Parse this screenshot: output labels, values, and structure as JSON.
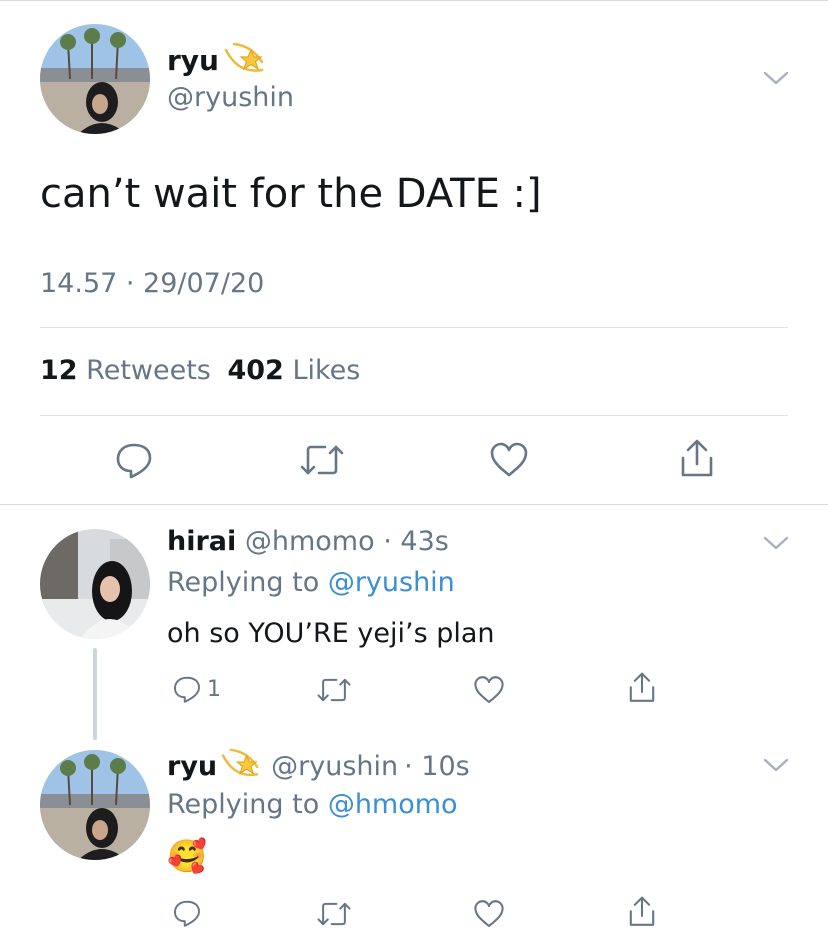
{
  "main_tweet": {
    "display_name": "ryu",
    "handle": "@ryushin",
    "text": "can’t wait for the DATE :]",
    "timestamp": "14.57 · 29/07/20",
    "retweets_count": "12",
    "retweets_label": "Retweets",
    "likes_count": "402",
    "likes_label": "Likes"
  },
  "replies": [
    {
      "display_name": "hirai",
      "handle": "@hmomo",
      "age": "· 43s",
      "replying_prefix": "Replying to",
      "replying_to": "@ryushin",
      "text": "oh so YOU’RE yeji’s plan",
      "reply_count": "1"
    },
    {
      "display_name": "ryu",
      "handle": "@ryushin",
      "age": "· 10s",
      "replying_prefix": "Replying to",
      "replying_to": "@hmomo",
      "text": "🥰"
    }
  ],
  "icons": {
    "sparkle": "dizzy-star-emoji",
    "reply": "speech-bubble",
    "retweet": "retweet-arrows",
    "like": "heart-outline",
    "share": "share-upload",
    "menu": "chevron-down"
  },
  "colors": {
    "link": "#3a8fd6",
    "secondary_text": "#657786",
    "primary_text": "#14171a"
  }
}
